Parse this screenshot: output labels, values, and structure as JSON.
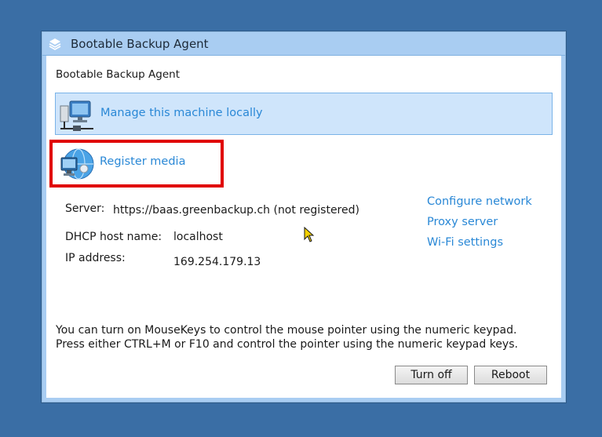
{
  "window": {
    "title": "Bootable Backup Agent",
    "heading": "Bootable Backup Agent"
  },
  "options": [
    {
      "label": "Manage this machine locally",
      "icon": "computer-network-icon",
      "selected": true
    },
    {
      "label": "Register media",
      "icon": "globe-computer-icon",
      "selected": false,
      "highlighted": true
    }
  ],
  "info": {
    "server_label": "Server:",
    "server_value": "https://baas.greenbackup.ch (not registered)",
    "dhcp_label": "DHCP host name:",
    "dhcp_value": "localhost",
    "ip_label": "IP address:",
    "ip_value": "169.254.179.13"
  },
  "links": {
    "configure_network": "Configure network",
    "proxy_server": "Proxy server",
    "wifi_settings": "Wi-Fi settings"
  },
  "note": {
    "line1": "You can turn on MouseKeys to control the mouse pointer using the numeric keypad.",
    "line2": "Press either CTRL+M or F10 and control the pointer using the numeric keypad keys."
  },
  "buttons": {
    "turn_off": "Turn off",
    "reboot": "Reboot"
  },
  "colors": {
    "desktop": "#3a6ea5",
    "titlebar": "#a9cdf2",
    "link": "#2a88d6",
    "selected_bg": "#cfe5fb",
    "highlight_border": "#e00000"
  }
}
